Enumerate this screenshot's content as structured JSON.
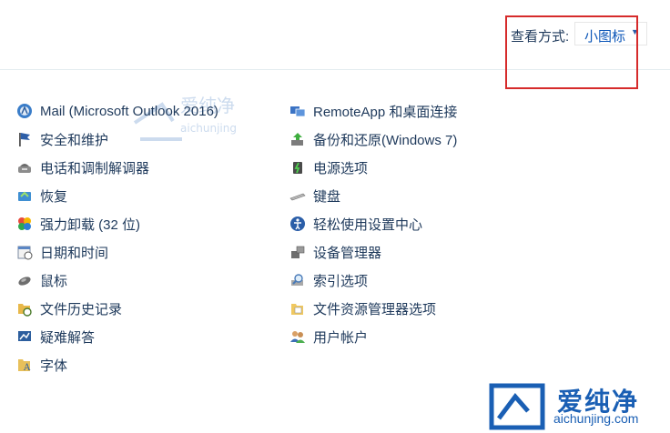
{
  "view": {
    "label": "查看方式:",
    "selected": "小图标"
  },
  "left_items": [
    {
      "label": "Mail (Microsoft Outlook 2016)",
      "icon": "mail-icon"
    },
    {
      "label": "安全和维护",
      "icon": "flag-icon"
    },
    {
      "label": "电话和调制解调器",
      "icon": "phone-modem-icon"
    },
    {
      "label": "恢复",
      "icon": "recovery-icon"
    },
    {
      "label": "强力卸载 (32 位)",
      "icon": "uninstall-icon"
    },
    {
      "label": "日期和时间",
      "icon": "calendar-icon"
    },
    {
      "label": "鼠标",
      "icon": "mouse-icon"
    },
    {
      "label": "文件历史记录",
      "icon": "file-history-icon"
    },
    {
      "label": "疑难解答",
      "icon": "troubleshoot-icon"
    },
    {
      "label": "字体",
      "icon": "fonts-icon"
    }
  ],
  "right_items": [
    {
      "label": "RemoteApp 和桌面连接",
      "icon": "remoteapp-icon"
    },
    {
      "label": "备份和还原(Windows 7)",
      "icon": "backup-icon"
    },
    {
      "label": "电源选项",
      "icon": "power-icon"
    },
    {
      "label": "键盘",
      "icon": "keyboard-icon"
    },
    {
      "label": "轻松使用设置中心",
      "icon": "ease-of-access-icon"
    },
    {
      "label": "设备管理器",
      "icon": "device-manager-icon"
    },
    {
      "label": "索引选项",
      "icon": "indexing-icon"
    },
    {
      "label": "文件资源管理器选项",
      "icon": "folder-options-icon"
    },
    {
      "label": "用户帐户",
      "icon": "user-accounts-icon"
    }
  ],
  "watermark": {
    "brand": "爱纯净",
    "url": "aichunjing.com"
  },
  "colors": {
    "link_text": "#1e395b",
    "accent": "#0d57b8",
    "highlight": "#d62b2b"
  }
}
